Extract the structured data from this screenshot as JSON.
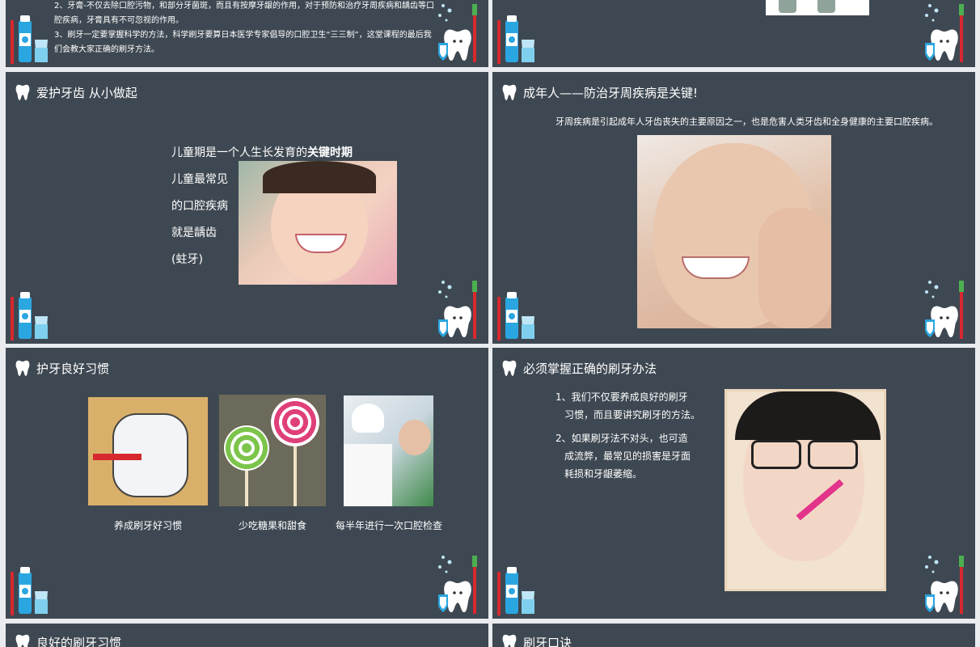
{
  "slides": {
    "s1": {
      "text2": "2、牙膏-不仅去除口腔污物，和部分牙菌斑，而且有按摩牙龈的作用，对于预防和治疗牙周疾病和龋齿等口",
      "text2b": "腔疾病，牙膏具有不可忽视的作用。",
      "text3": "3、刷牙一定要掌握科学的方法，科学刷牙要算日本医学专家倡导的口腔卫生“三三制”，这堂课程的最后我",
      "text3b": "们会教大家正确的刷牙方法。"
    },
    "s3": {
      "title": "爱护牙齿 从小做起",
      "line1_pre": "儿童期是一个人生长发育的",
      "line1_bold": "关键时期",
      "line2": "儿童最常见",
      "line3": "的口腔疾病",
      "line4": "就是龋齿",
      "line5": "(蛀牙)"
    },
    "s4": {
      "title": "成年人——防治牙周疾病是关键!",
      "text": "牙周疾病是引起成年人牙齿丧失的主要原因之一，也是危害人类牙齿和全身健康的主要口腔疾病。"
    },
    "s5": {
      "title": "护牙良好习惯",
      "cap1": "养成刷牙好习惯",
      "cap2": "少吃糖果和甜食",
      "cap3": "每半年进行一次口腔检查"
    },
    "s6": {
      "title": "必须掌握正确的刷牙办法",
      "p1a": "1、我们不仅要养成良好的刷牙",
      "p1b": "习惯，而且要讲究刷牙的方法。",
      "p2a": "2、如果刷牙法不对头，也可造",
      "p2b": "成流弊，最常见的损害是牙面",
      "p2c": "耗损和牙龈萎缩。"
    },
    "s7": {
      "title": "良好的刷牙习惯"
    },
    "s8": {
      "title": "刷牙口诀"
    }
  },
  "colors": {
    "slide_bg": "#3e4852",
    "page_bg": "#e9ebee",
    "accent_blue": "#2aa6e0",
    "accent_red": "#d8282f"
  }
}
